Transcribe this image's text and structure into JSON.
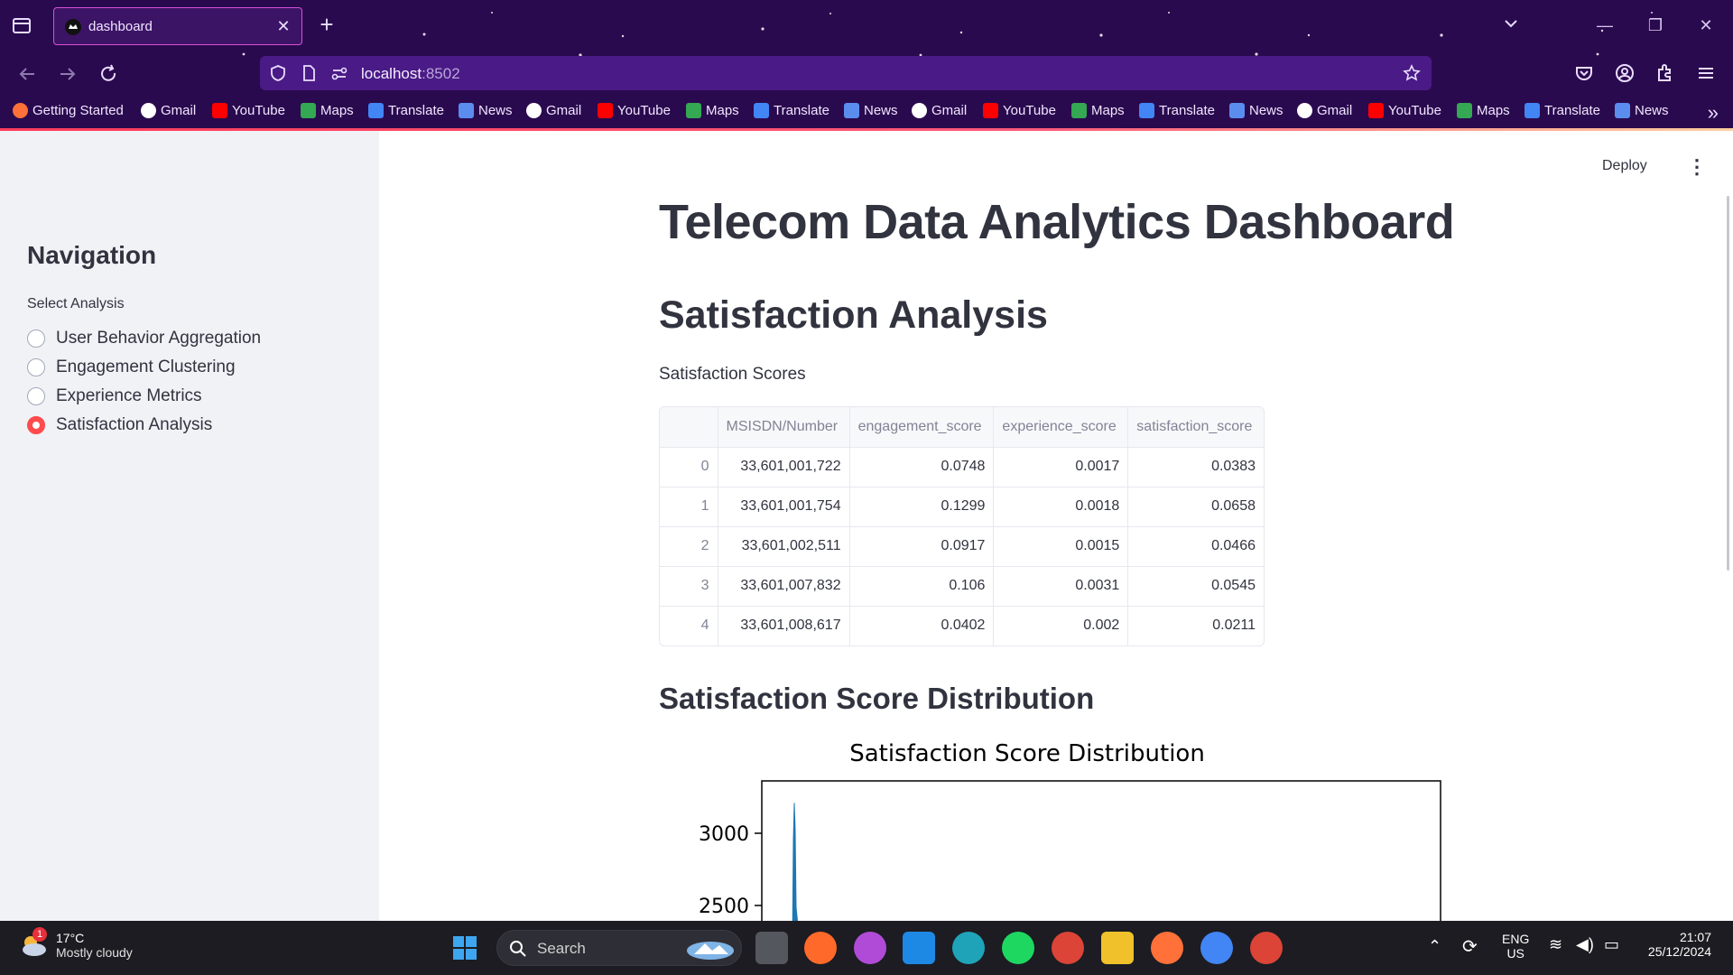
{
  "browser": {
    "tab_title": "dashboard",
    "url_host": "localhost",
    "url_port": ":8502",
    "bookmarks": [
      "Getting Started",
      "Gmail",
      "YouTube",
      "Maps",
      "Translate",
      "News",
      "Gmail",
      "YouTube",
      "Maps",
      "Translate",
      "News",
      "Gmail",
      "YouTube",
      "Maps",
      "Translate",
      "News",
      "Gmail",
      "YouTube",
      "Maps",
      "Translate",
      "News"
    ],
    "theme_color": "#2a0a4e",
    "accent_color": "#ff3b5c"
  },
  "app": {
    "deploy_label": "Deploy",
    "title": "Telecom Data Analytics Dashboard",
    "section_title": "Satisfaction Analysis",
    "table_caption": "Satisfaction Scores",
    "distribution_heading": "Satisfaction Score Distribution"
  },
  "sidebar": {
    "heading": "Navigation",
    "select_label": "Select Analysis",
    "options": [
      {
        "label": "User Behavior Aggregation",
        "checked": false
      },
      {
        "label": "Engagement Clustering",
        "checked": false
      },
      {
        "label": "Experience Metrics",
        "checked": false
      },
      {
        "label": "Satisfaction Analysis",
        "checked": true
      }
    ],
    "accent_color": "#ff4b4b"
  },
  "table": {
    "columns": [
      "",
      "MSISDN/Number",
      "engagement_score",
      "experience_score",
      "satisfaction_score"
    ],
    "rows": [
      [
        "0",
        "33,601,001,722",
        "0.0748",
        "0.0017",
        "0.0383"
      ],
      [
        "1",
        "33,601,001,754",
        "0.1299",
        "0.0018",
        "0.0658"
      ],
      [
        "2",
        "33,601,002,511",
        "0.0917",
        "0.0015",
        "0.0466"
      ],
      [
        "3",
        "33,601,007,832",
        "0.106",
        "0.0031",
        "0.0545"
      ],
      [
        "4",
        "33,601,008,617",
        "0.0402",
        "0.002",
        "0.0211"
      ]
    ]
  },
  "chart_data": {
    "type": "area",
    "title": "Satisfaction Score Distribution",
    "xlabel": "",
    "ylabel": "",
    "yticks": [
      3000,
      2500
    ],
    "peak_value": 3210,
    "color": "#1f77b4"
  },
  "taskbar": {
    "temperature": "17°C",
    "condition": "Mostly cloudy",
    "notification_count": "1",
    "search_label": "Search",
    "language": "ENG",
    "region": "US",
    "time": "21:07",
    "date": "25/12/2024"
  }
}
